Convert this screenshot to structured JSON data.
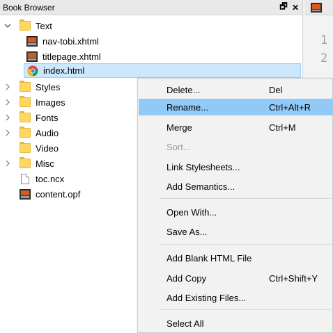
{
  "panel": {
    "title": "Book Browser",
    "float_btn": "🗗",
    "close_btn": "✕"
  },
  "editor": {
    "line_numbers": [
      "1",
      "2"
    ]
  },
  "tree": {
    "text_folder": "Text",
    "files": [
      "nav-tobi.xhtml",
      "titlepage.xhtml",
      "index.html"
    ],
    "folders": [
      "Styles",
      "Images",
      "Fonts",
      "Audio",
      "Video",
      "Misc"
    ],
    "toc": "toc.ncx",
    "opf": "content.opf"
  },
  "menu": {
    "delete": {
      "label": "Delete...",
      "shortcut": "Del"
    },
    "rename": {
      "label": "Rename...",
      "shortcut": "Ctrl+Alt+R"
    },
    "merge": {
      "label": "Merge",
      "shortcut": "Ctrl+M"
    },
    "sort": {
      "label": "Sort..."
    },
    "link_stylesheets": {
      "label": "Link Stylesheets..."
    },
    "add_semantics": {
      "label": "Add Semantics..."
    },
    "open_with": {
      "label": "Open With..."
    },
    "save_as": {
      "label": "Save As..."
    },
    "add_blank": {
      "label": "Add Blank HTML File"
    },
    "add_copy": {
      "label": "Add Copy",
      "shortcut": "Ctrl+Shift+Y"
    },
    "add_existing": {
      "label": "Add Existing Files..."
    },
    "select_all": {
      "label": "Select All"
    }
  },
  "colors": {
    "folder": "#ffd75e",
    "selection": "#cce8ff",
    "menu_highlight": "#91c9f7",
    "sigil_icon": "#d45a1f"
  }
}
